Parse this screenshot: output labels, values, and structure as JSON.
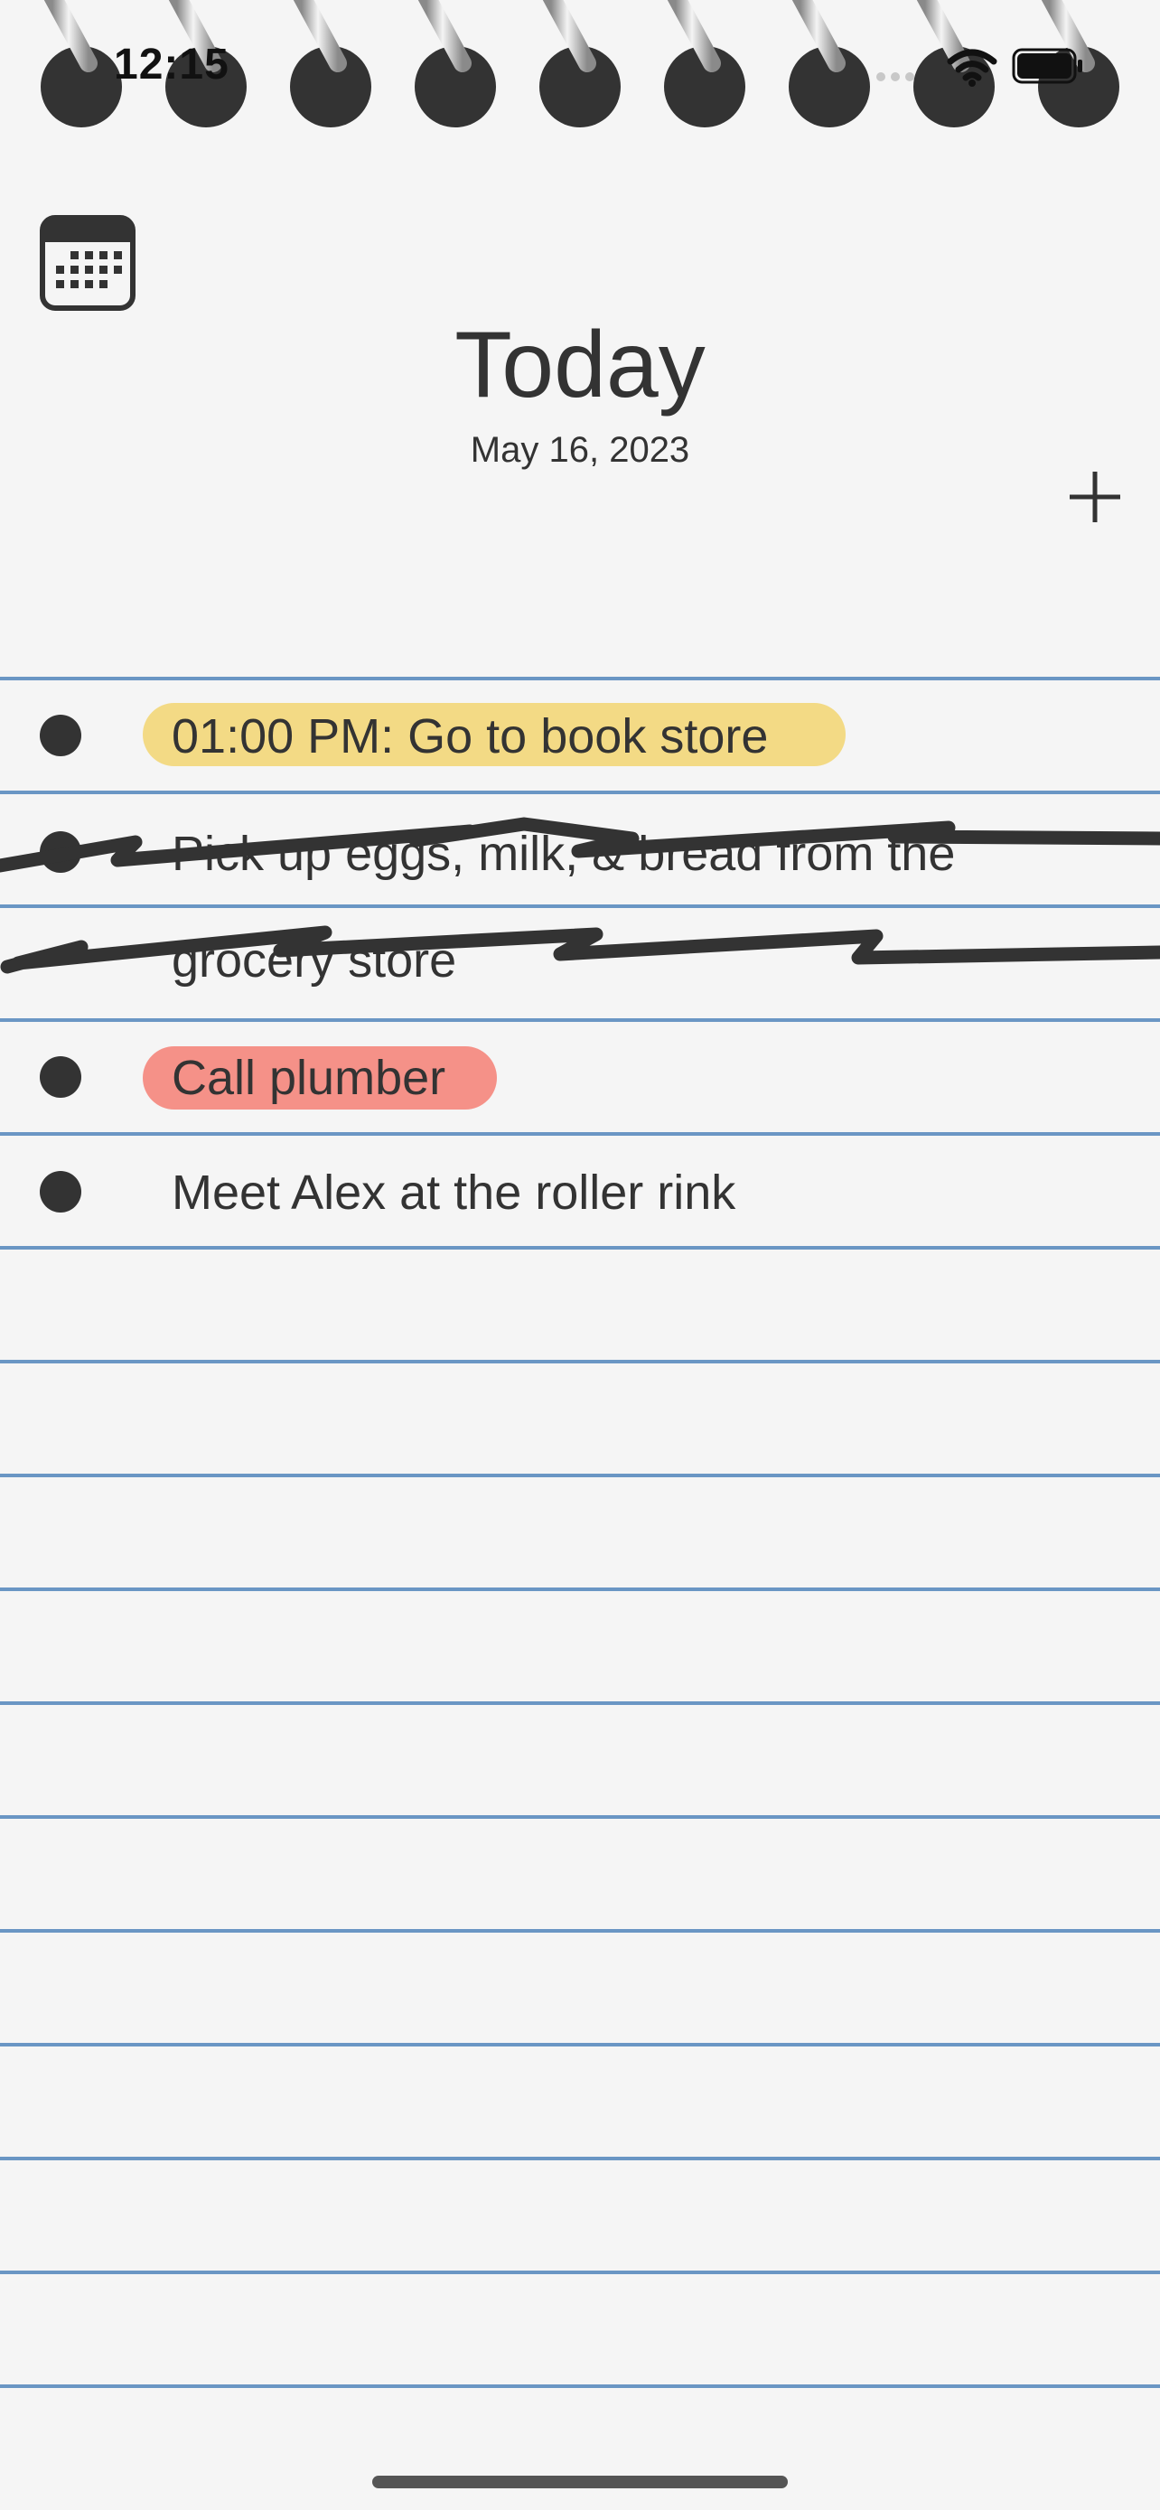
{
  "status_bar": {
    "time": "12:15"
  },
  "header": {
    "title": "Today",
    "date": "May 16, 2023"
  },
  "tasks": [
    {
      "text": "01:00 PM: Go to book store",
      "highlight": "#f3da85",
      "completed": false
    },
    {
      "text_line1": "Pick up eggs, milk, & bread from the",
      "text_line2": "grocery store",
      "completed": true
    },
    {
      "text": "Call plumber",
      "highlight": "#f59188",
      "completed": false
    },
    {
      "text": "Meet Alex at the roller rink",
      "completed": false
    }
  ],
  "colors": {
    "background": "#f5f5f5",
    "rule_line": "#6a96c4",
    "ink": "#333333",
    "yellow_highlight": "#f3da85",
    "red_highlight": "#f59188"
  },
  "icons": {
    "calendar": "calendar-icon",
    "add": "plus-icon",
    "wifi": "wifi-icon",
    "battery": "battery-icon"
  }
}
